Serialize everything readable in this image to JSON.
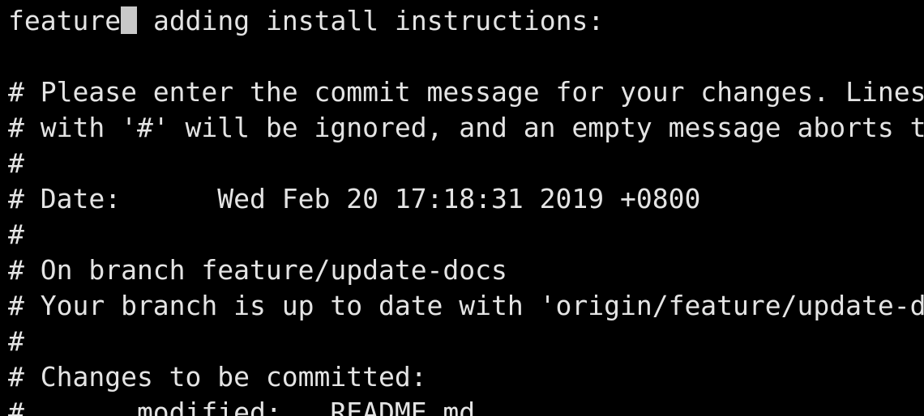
{
  "colors": {
    "background": "#000000",
    "foreground": "#e4e4e4",
    "cursor": "#c8c8c8"
  },
  "editor": {
    "subject": {
      "before_cursor": "feature",
      "after_cursor": " adding install instructions:"
    },
    "lines": [
      "",
      "# Please enter the commit message for your changes. Lines starting",
      "# with '#' will be ignored, and an empty message aborts the commit.",
      "#",
      "# Date:      Wed Feb 20 17:18:31 2019 +0800",
      "#",
      "# On branch feature/update-docs",
      "# Your branch is up to date with 'origin/feature/update-docs'.",
      "#",
      "# Changes to be committed:",
      "#       modified:   README.md"
    ]
  }
}
